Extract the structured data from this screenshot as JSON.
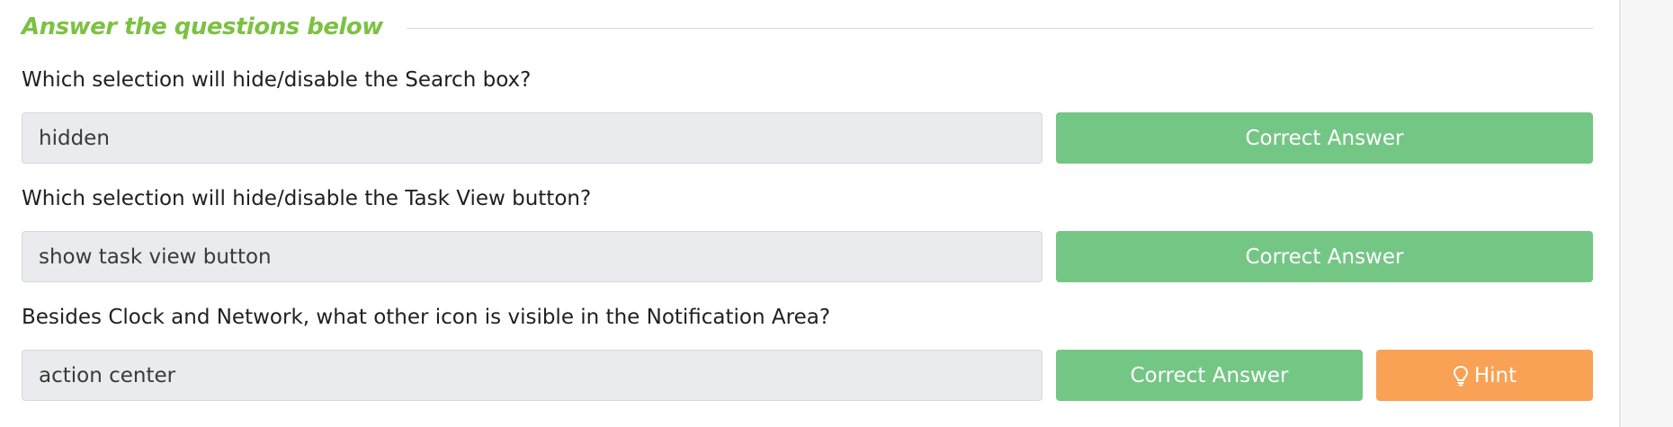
{
  "section": {
    "title": "Answer the questions below"
  },
  "questions": [
    {
      "text": "Which selection will hide/disable the Search box?",
      "answer": "hidden",
      "button": "Correct Answer"
    },
    {
      "text": "Which selection will hide/disable the Task View button?",
      "answer": "show task view button",
      "button": "Correct Answer"
    },
    {
      "text": "Besides Clock and Network, what other icon is visible in the Notification Area?",
      "answer": "action center",
      "button": "Correct Answer",
      "hint": "Hint"
    }
  ],
  "colors": {
    "title": "#7cc242",
    "correct_button": "#74c685",
    "hint_button": "#f9a155",
    "answer_field": "#e9ebee"
  },
  "icons": {
    "hint": "lightbulb-icon"
  }
}
